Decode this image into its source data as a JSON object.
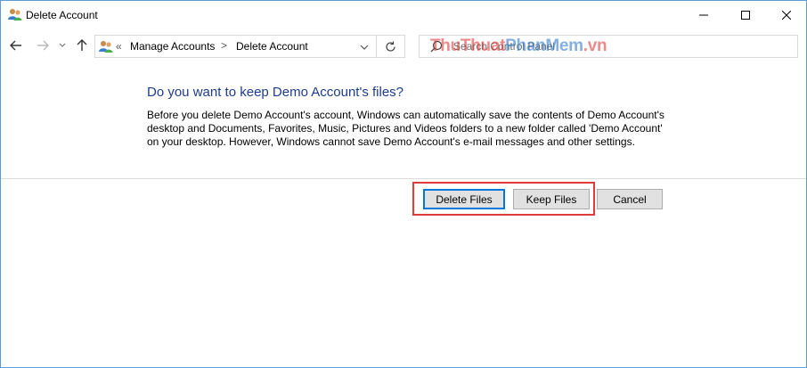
{
  "window": {
    "title": "Delete Account",
    "icon": "users-icon"
  },
  "controls": {
    "minimize": "minimize-icon",
    "maximize": "maximize-icon",
    "close": "close-icon"
  },
  "address": {
    "prefix": "«",
    "crumb1": "Manage Accounts",
    "separator": ">",
    "crumb2": "Delete Account"
  },
  "search": {
    "placeholder": "Search Control Panel",
    "watermark_a": "ThuThuat",
    "watermark_b": "PhanMem",
    "watermark_c": ".vn"
  },
  "dialog": {
    "heading": "Do you want to keep Demo Account's files?",
    "body": "Before you delete Demo Account's account, Windows can automatically save the contents of Demo Account's desktop and Documents, Favorites, Music, Pictures and Videos folders to a new folder called 'Demo Account' on your desktop. However, Windows cannot save Demo Account's e-mail messages and other settings.",
    "buttons": {
      "delete": "Delete Files",
      "keep": "Keep Files",
      "cancel": "Cancel"
    }
  },
  "colors": {
    "heading": "#1e3d8f",
    "highlight": "#e03c3c",
    "focus": "#0078d7"
  }
}
